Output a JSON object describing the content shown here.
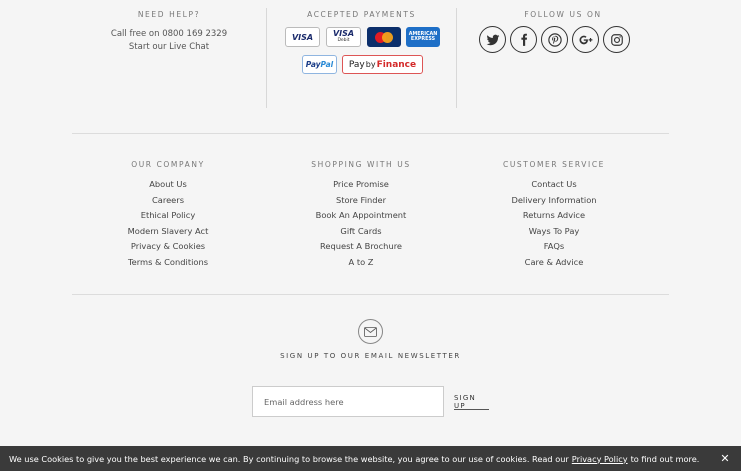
{
  "help": {
    "heading": "NEED HELP?",
    "call": "Call free on 0800 169 2329",
    "chat": "Start our Live Chat"
  },
  "payments": {
    "heading": "ACCEPTED PAYMENTS",
    "visa": "VISA",
    "visa_debit": "VISA",
    "visa_debit_sub": "Debit",
    "amex_line1": "AMERICAN",
    "amex_line2": "EXPRESS",
    "paypal_a": "Pay",
    "paypal_b": "Pal",
    "pbf_pay": "Pay",
    "pbf_by": "by",
    "pbf_finance": "Finance"
  },
  "follow": {
    "heading": "FOLLOW US ON"
  },
  "columns": [
    {
      "heading": "OUR COMPANY",
      "items": [
        "About Us",
        "Careers",
        "Ethical Policy",
        "Modern Slavery Act",
        "Privacy & Cookies",
        "Terms & Conditions"
      ]
    },
    {
      "heading": "SHOPPING WITH US",
      "items": [
        "Price Promise",
        "Store Finder",
        "Book An Appointment",
        "Gift Cards",
        "Request A Brochure",
        "A to Z"
      ]
    },
    {
      "heading": "CUSTOMER SERVICE",
      "items": [
        "Contact Us",
        "Delivery Information",
        "Returns Advice",
        "Ways To Pay",
        "FAQs",
        "Care & Advice"
      ]
    }
  ],
  "newsletter": {
    "heading": "SIGN UP TO OUR EMAIL NEWSLETTER",
    "placeholder": "Email address here",
    "button": "SIGN UP"
  },
  "cookie": {
    "text": "We use Cookies to give you the best experience we can. By continuing to browse the website, you agree to our use of cookies. Read our",
    "link": "Privacy Policy",
    "after": "to find out more.",
    "close": "✕"
  }
}
